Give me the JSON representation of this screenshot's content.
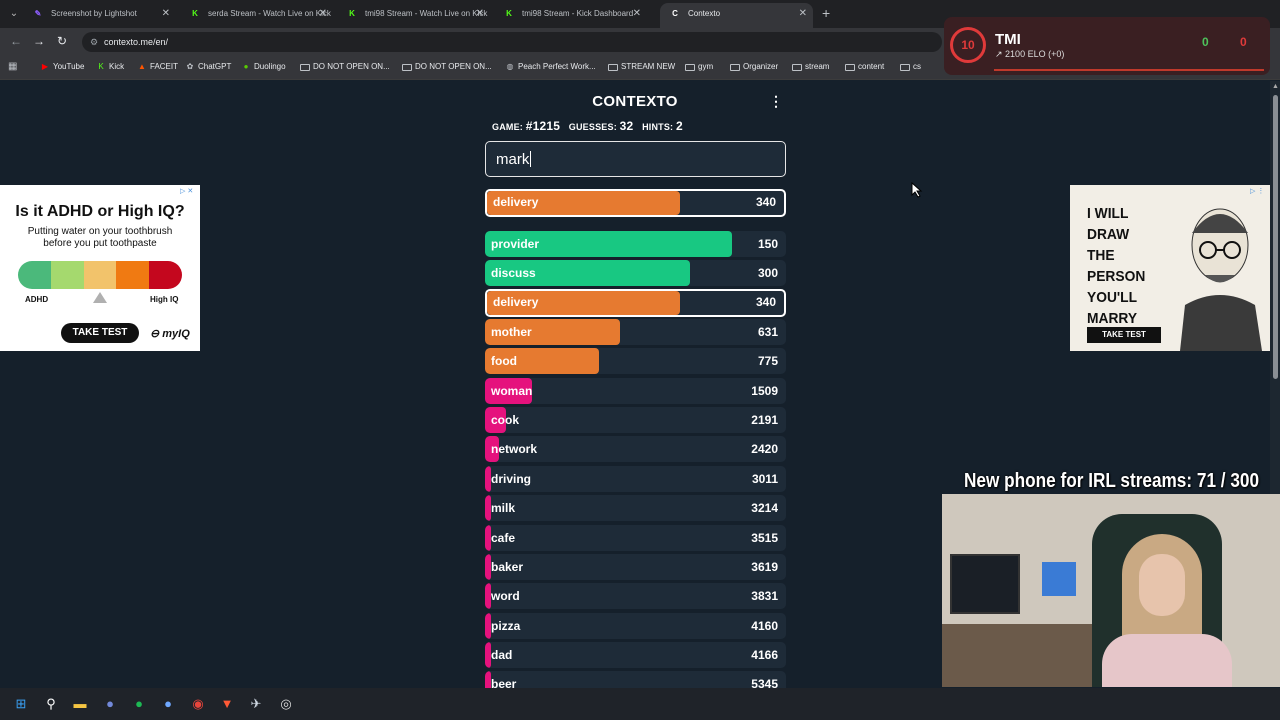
{
  "browser": {
    "tabs": [
      {
        "title": "Screenshot by Lightshot",
        "fav": "",
        "fav_color": "#8a5cf6"
      },
      {
        "title": "serda Stream - Watch Live on Kick",
        "fav": "K",
        "fav_color": "#53fc18"
      },
      {
        "title": "tmi98 Stream - Watch Live on Kick",
        "fav": "K",
        "fav_color": "#53fc18"
      },
      {
        "title": "tmi98 Stream - Kick Dashboard",
        "fav": "K",
        "fav_color": "#53fc18"
      },
      {
        "title": "Contexto",
        "fav": "C",
        "fav_color": "#ffffff"
      }
    ],
    "url": "contexto.me/en/",
    "bookmarks": [
      {
        "label": "YouTube",
        "icon": "youtube-icon"
      },
      {
        "label": "Kick",
        "icon": "kick-icon"
      },
      {
        "label": "FACEIT",
        "icon": "faceit-icon"
      },
      {
        "label": "ChatGPT",
        "icon": "chatgpt-icon"
      },
      {
        "label": "Duolingo",
        "icon": "duolingo-icon"
      },
      {
        "label": "DO NOT OPEN ON...",
        "icon": "folder-icon"
      },
      {
        "label": "DO NOT OPEN ON...",
        "icon": "folder-icon"
      },
      {
        "label": "Peach Perfect Work...",
        "icon": "globe-icon"
      },
      {
        "label": "STREAM NEW",
        "icon": "folder-icon"
      },
      {
        "label": "gym",
        "icon": "folder-icon"
      },
      {
        "label": "Organizer",
        "icon": "folder-icon"
      },
      {
        "label": "stream",
        "icon": "folder-icon"
      },
      {
        "label": "content",
        "icon": "folder-icon"
      },
      {
        "label": "cs",
        "icon": "folder-icon"
      }
    ]
  },
  "game": {
    "title": "CONTEXTO",
    "game_label": "GAME:",
    "game_number": "#1215",
    "guesses_label": "GUESSES:",
    "guesses": "32",
    "hints_label": "HINTS:",
    "hints": "2",
    "input_value": "mark",
    "last_guess": {
      "word": "delivery",
      "distance": "340",
      "color": "#e67a30",
      "fill": 0.65
    },
    "guesses_list": [
      {
        "word": "provider",
        "distance": "150",
        "color": "#18c882",
        "fill": 0.82
      },
      {
        "word": "discuss",
        "distance": "300",
        "color": "#18c882",
        "fill": 0.68
      },
      {
        "word": "delivery",
        "distance": "340",
        "color": "#e67a30",
        "fill": 0.65,
        "highlight": true
      },
      {
        "word": "mother",
        "distance": "631",
        "color": "#e67a30",
        "fill": 0.45
      },
      {
        "word": "food",
        "distance": "775",
        "color": "#e67a30",
        "fill": 0.38
      },
      {
        "word": "woman",
        "distance": "1509",
        "color": "#e5127d",
        "fill": 0.155
      },
      {
        "word": "cook",
        "distance": "2191",
        "color": "#e5127d",
        "fill": 0.07
      },
      {
        "word": "network",
        "distance": "2420",
        "color": "#e5127d",
        "fill": 0.045
      },
      {
        "word": "driving",
        "distance": "3011",
        "color": "#e5127d",
        "fill": 0.02
      },
      {
        "word": "milk",
        "distance": "3214",
        "color": "#e5127d",
        "fill": 0.015
      },
      {
        "word": "cafe",
        "distance": "3515",
        "color": "#e5127d",
        "fill": 0.012
      },
      {
        "word": "baker",
        "distance": "3619",
        "color": "#e5127d",
        "fill": 0.011
      },
      {
        "word": "word",
        "distance": "3831",
        "color": "#e5127d",
        "fill": 0.01
      },
      {
        "word": "pizza",
        "distance": "4160",
        "color": "#e5127d",
        "fill": 0.009
      },
      {
        "word": "dad",
        "distance": "4166",
        "color": "#e5127d",
        "fill": 0.009
      },
      {
        "word": "beer",
        "distance": "5345",
        "color": "#e5127d",
        "fill": 0.007
      }
    ]
  },
  "ads": {
    "left": {
      "headline": "Is it ADHD or High IQ?",
      "sub": "Putting water on your toothbrush before you put toothpaste",
      "left_label": "ADHD",
      "right_label": "High IQ",
      "button": "TAKE TEST",
      "brand": "myIQ"
    },
    "right": {
      "text_lines": [
        "I WILL",
        "DRAW",
        "THE",
        "PERSON",
        "YOU'LL",
        "MARRY"
      ],
      "button": "TAKE TEST"
    }
  },
  "overlay": {
    "level": "10",
    "name": "TMI",
    "elo": "2100 ELO (+0)",
    "wins": "0",
    "losses": "0",
    "goal_text": "New phone for IRL streams:  71 / 300"
  }
}
